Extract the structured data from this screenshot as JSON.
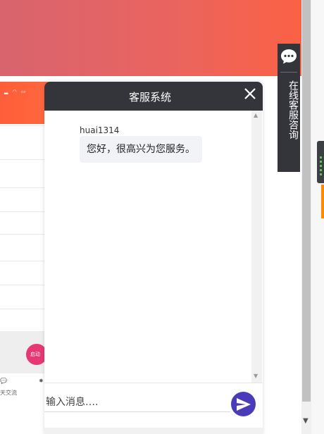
{
  "chat": {
    "title": "客服系统",
    "messages": [
      {
        "sender": "huai1314",
        "text": "您好，很高兴为您服务。"
      }
    ],
    "input_placeholder": "输入消息….",
    "send_icon": "send-icon",
    "close_icon": "close-icon"
  },
  "side_tab": {
    "label": "在线客服咨询",
    "icon": "chat-bubble-icon"
  },
  "background": {
    "bottom_caption": "天交流",
    "pink_button": "启动",
    "colors": {
      "banner_start": "#d8646e",
      "banner_end": "#fb6245",
      "header_dark": "#34353b",
      "send_button": "#4a3bb8",
      "bubble": "#f2f3f7"
    }
  }
}
